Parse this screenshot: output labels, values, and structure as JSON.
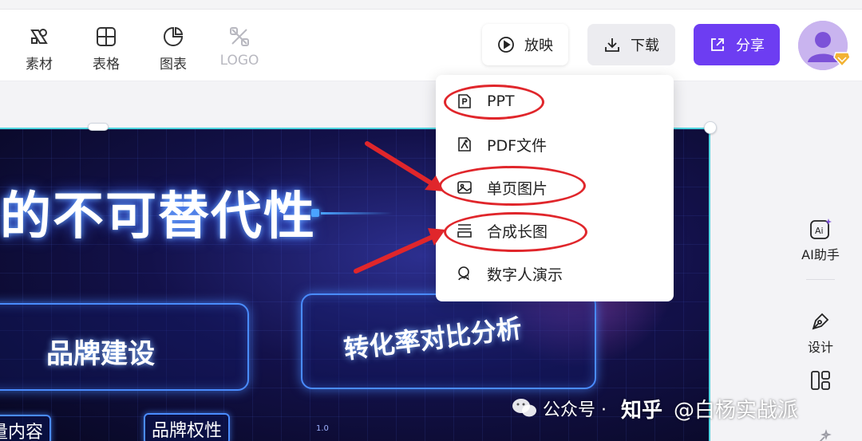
{
  "toolbar": {
    "tools": [
      {
        "label": "素材",
        "icon": "material-icon"
      },
      {
        "label": "表格",
        "icon": "table-icon"
      },
      {
        "label": "图表",
        "icon": "chart-icon"
      },
      {
        "label": "LOGO",
        "icon": "logo-icon"
      }
    ],
    "play_label": "放映",
    "download_label": "下载",
    "share_label": "分享",
    "accent_color": "#6d3df2"
  },
  "download_menu": {
    "items": [
      {
        "label": "PPT",
        "icon": "ppt-file-icon"
      },
      {
        "label": "PDF文件",
        "icon": "pdf-file-icon"
      },
      {
        "label": "单页图片",
        "icon": "image-icon"
      },
      {
        "label": "合成长图",
        "icon": "long-image-icon"
      },
      {
        "label": "数字人演示",
        "icon": "digital-human-icon"
      }
    ],
    "highlighted": [
      "PPT",
      "单页图片",
      "合成长图"
    ],
    "highlight_color": "#e0262b"
  },
  "slide": {
    "title": "的不可替代性",
    "panel_left": "品牌建设",
    "panel_right": "转化率对比分析",
    "box_left": "量内容",
    "box_right": "品牌权性",
    "axis_value": "1.0"
  },
  "right_sidebar": {
    "ai_label": "AI助手",
    "design_label": "设计"
  },
  "watermark": {
    "channel": "公众号 ·",
    "site": "知乎",
    "author": "@白杨实战派"
  }
}
